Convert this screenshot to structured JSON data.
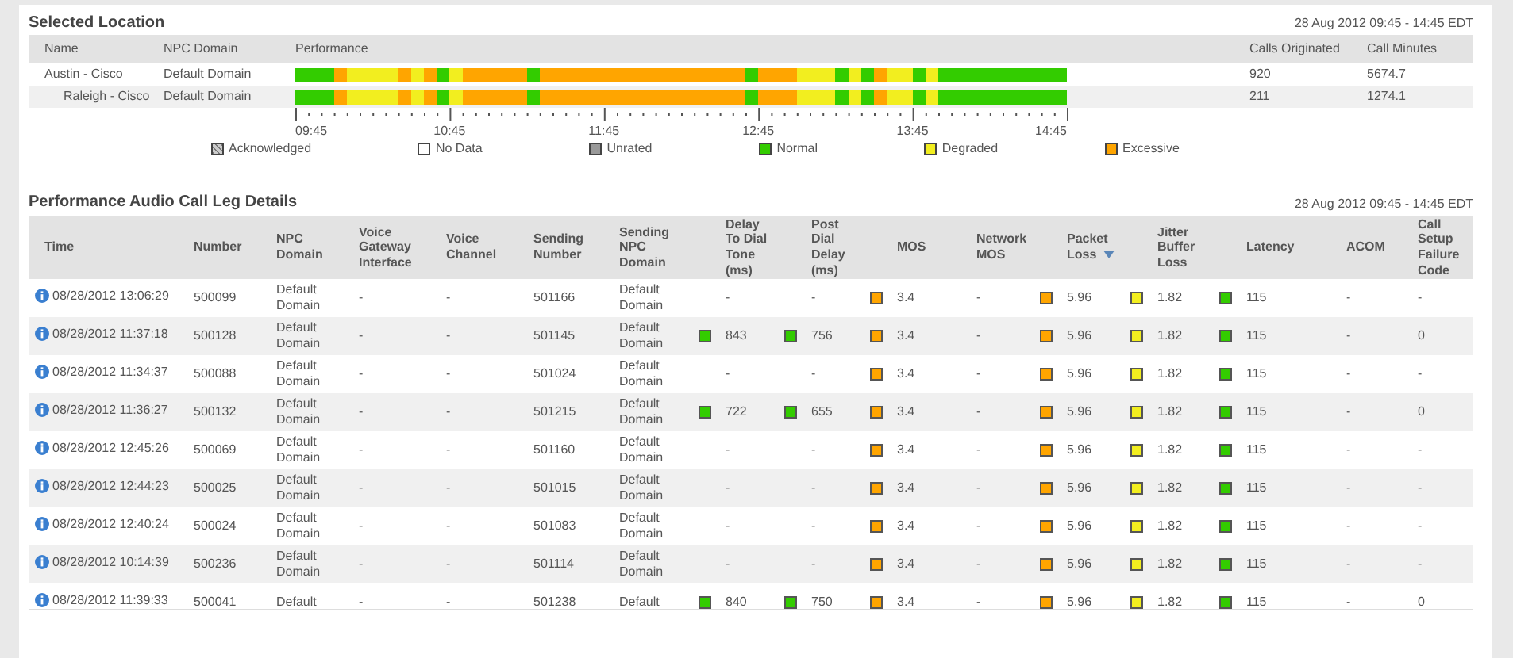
{
  "selected_location": {
    "title": "Selected Location",
    "time_range": "28 Aug 2012 09:45 - 14:45 EDT",
    "columns": [
      "Name",
      "NPC Domain",
      "Performance",
      "Calls Originated",
      "Call Minutes"
    ],
    "locations": [
      {
        "name": "Austin - Cisco",
        "npc_domain": "Default Domain",
        "performance": [
          {
            "color": "#33cc00"
          },
          {
            "color": "#33cc00"
          },
          {
            "color": "#33cc00"
          },
          {
            "color": "#ffa500"
          },
          {
            "color": "#f2ee1f"
          },
          {
            "color": "#f2ee1f"
          },
          {
            "color": "#f2ee1f"
          },
          {
            "color": "#f2ee1f"
          },
          {
            "color": "#ffa500"
          },
          {
            "color": "#f2ee1f"
          },
          {
            "color": "#ffa500"
          },
          {
            "color": "#33cc00"
          },
          {
            "color": "#f2ee1f"
          },
          {
            "color": "#ffa500"
          },
          {
            "color": "#ffa500"
          },
          {
            "color": "#ffa500"
          },
          {
            "color": "#ffa500"
          },
          {
            "color": "#ffa500"
          },
          {
            "color": "#33cc00"
          },
          {
            "color": "#ffa500"
          },
          {
            "color": "#ffa500"
          },
          {
            "color": "#ffa500"
          },
          {
            "color": "#ffa500"
          },
          {
            "color": "#ffa500"
          },
          {
            "color": "#ffa500"
          },
          {
            "color": "#ffa500"
          },
          {
            "color": "#ffa500"
          },
          {
            "color": "#ffa500"
          },
          {
            "color": "#ffa500"
          },
          {
            "color": "#ffa500"
          },
          {
            "color": "#ffa500"
          },
          {
            "color": "#ffa500"
          },
          {
            "color": "#ffa500"
          },
          {
            "color": "#ffa500"
          },
          {
            "color": "#ffa500"
          },
          {
            "color": "#33cc00"
          },
          {
            "color": "#ffa500"
          },
          {
            "color": "#ffa500"
          },
          {
            "color": "#ffa500"
          },
          {
            "color": "#f2ee1f"
          },
          {
            "color": "#f2ee1f"
          },
          {
            "color": "#f2ee1f"
          },
          {
            "color": "#33cc00"
          },
          {
            "color": "#f2ee1f"
          },
          {
            "color": "#33cc00"
          },
          {
            "color": "#ffa500"
          },
          {
            "color": "#f2ee1f"
          },
          {
            "color": "#f2ee1f"
          },
          {
            "color": "#33cc00"
          },
          {
            "color": "#f2ee1f"
          },
          {
            "color": "#33cc00"
          },
          {
            "color": "#33cc00"
          },
          {
            "color": "#33cc00"
          },
          {
            "color": "#33cc00"
          },
          {
            "color": "#33cc00"
          },
          {
            "color": "#33cc00"
          },
          {
            "color": "#33cc00"
          },
          {
            "color": "#33cc00"
          },
          {
            "color": "#33cc00"
          },
          {
            "color": "#33cc00"
          }
        ],
        "calls_originated": "920",
        "call_minutes": "5674.7",
        "children": [
          {
            "name": "Raleigh - Cisco",
            "npc_domain": "Default Domain",
            "performance": [
              {
                "color": "#33cc00"
              },
              {
                "color": "#33cc00"
              },
              {
                "color": "#33cc00"
              },
              {
                "color": "#ffa500"
              },
              {
                "color": "#f2ee1f"
              },
              {
                "color": "#f2ee1f"
              },
              {
                "color": "#f2ee1f"
              },
              {
                "color": "#f2ee1f"
              },
              {
                "color": "#ffa500"
              },
              {
                "color": "#f2ee1f"
              },
              {
                "color": "#ffa500"
              },
              {
                "color": "#33cc00"
              },
              {
                "color": "#f2ee1f"
              },
              {
                "color": "#ffa500"
              },
              {
                "color": "#ffa500"
              },
              {
                "color": "#ffa500"
              },
              {
                "color": "#ffa500"
              },
              {
                "color": "#ffa500"
              },
              {
                "color": "#33cc00"
              },
              {
                "color": "#ffa500"
              },
              {
                "color": "#ffa500"
              },
              {
                "color": "#ffa500"
              },
              {
                "color": "#ffa500"
              },
              {
                "color": "#ffa500"
              },
              {
                "color": "#ffa500"
              },
              {
                "color": "#ffa500"
              },
              {
                "color": "#ffa500"
              },
              {
                "color": "#ffa500"
              },
              {
                "color": "#ffa500"
              },
              {
                "color": "#ffa500"
              },
              {
                "color": "#ffa500"
              },
              {
                "color": "#ffa500"
              },
              {
                "color": "#ffa500"
              },
              {
                "color": "#ffa500"
              },
              {
                "color": "#ffa500"
              },
              {
                "color": "#33cc00"
              },
              {
                "color": "#ffa500"
              },
              {
                "color": "#ffa500"
              },
              {
                "color": "#ffa500"
              },
              {
                "color": "#f2ee1f"
              },
              {
                "color": "#f2ee1f"
              },
              {
                "color": "#f2ee1f"
              },
              {
                "color": "#33cc00"
              },
              {
                "color": "#f2ee1f"
              },
              {
                "color": "#33cc00"
              },
              {
                "color": "#ffa500"
              },
              {
                "color": "#f2ee1f"
              },
              {
                "color": "#f2ee1f"
              },
              {
                "color": "#33cc00"
              },
              {
                "color": "#f2ee1f"
              },
              {
                "color": "#33cc00"
              },
              {
                "color": "#33cc00"
              },
              {
                "color": "#33cc00"
              },
              {
                "color": "#33cc00"
              },
              {
                "color": "#33cc00"
              },
              {
                "color": "#33cc00"
              },
              {
                "color": "#33cc00"
              },
              {
                "color": "#33cc00"
              },
              {
                "color": "#33cc00"
              },
              {
                "color": "#33cc00"
              }
            ],
            "calls_originated": "211",
            "call_minutes": "1274.1"
          }
        ]
      }
    ],
    "axis_labels": [
      "09:45",
      "10:45",
      "11:45",
      "12:45",
      "13:45",
      "14:45"
    ],
    "legend": [
      {
        "label": "Acknowledged",
        "color": "#cccccc",
        "hatched": true
      },
      {
        "label": "No Data",
        "color": "#ffffff",
        "hatched": false
      },
      {
        "label": "Unrated",
        "color": "#999999",
        "hatched": false
      },
      {
        "label": "Normal",
        "color": "#33cc00",
        "hatched": false
      },
      {
        "label": "Degraded",
        "color": "#f2ee1f",
        "hatched": false
      },
      {
        "label": "Excessive",
        "color": "#ffa500",
        "hatched": false
      }
    ]
  },
  "call_leg_details": {
    "title": "Performance Audio Call Leg Details",
    "time_range": "28 Aug 2012 09:45 - 14:45 EDT",
    "columns": [
      {
        "label": "Time",
        "kind": "time",
        "sorted": false
      },
      {
        "label": "Number",
        "kind": "text",
        "sorted": false
      },
      {
        "label": "NPC Domain",
        "kind": "text",
        "sorted": false
      },
      {
        "label": "Voice Gateway Interface",
        "kind": "text",
        "sorted": false
      },
      {
        "label": "Voice Channel",
        "kind": "text",
        "sorted": false
      },
      {
        "label": "Sending Number",
        "kind": "text",
        "sorted": false
      },
      {
        "label": "Sending NPC Domain",
        "kind": "text",
        "sorted": false
      },
      {
        "label": "Delay To Dial Tone (ms)",
        "kind": "indicator",
        "sorted": false
      },
      {
        "label": "Post Dial Delay (ms)",
        "kind": "indicator",
        "sorted": false
      },
      {
        "label": "MOS",
        "kind": "indicator",
        "sorted": false
      },
      {
        "label": "Network MOS",
        "kind": "text",
        "sorted": false
      },
      {
        "label": "Packet Loss",
        "kind": "indicator",
        "sorted": true
      },
      {
        "label": "Jitter Buffer Loss",
        "kind": "indicator",
        "sorted": false
      },
      {
        "label": "Latency",
        "kind": "indicator",
        "sorted": false
      },
      {
        "label": "ACOM",
        "kind": "text",
        "sorted": false
      },
      {
        "label": "Call Setup Failure Code",
        "kind": "text",
        "sorted": false
      }
    ],
    "rows": [
      {
        "cells": [
          {
            "text": "08/28/2012 13:06:29"
          },
          {
            "text": "500099"
          },
          {
            "text": "Default Domain"
          },
          {
            "text": "-"
          },
          {
            "text": "-"
          },
          {
            "text": "501166"
          },
          {
            "text": "Default Domain"
          },
          {
            "text": "-"
          },
          {
            "text": "-"
          },
          {
            "text": "3.4",
            "color": "#ffa500"
          },
          {
            "text": "-"
          },
          {
            "text": "5.96",
            "color": "#ffa500"
          },
          {
            "text": "1.82",
            "color": "#f2ee1f"
          },
          {
            "text": "115",
            "color": "#33cc00"
          },
          {
            "text": "-"
          },
          {
            "text": "-"
          }
        ]
      },
      {
        "cells": [
          {
            "text": "08/28/2012 11:37:18"
          },
          {
            "text": "500128"
          },
          {
            "text": "Default Domain"
          },
          {
            "text": "-"
          },
          {
            "text": "-"
          },
          {
            "text": "501145"
          },
          {
            "text": "Default Domain"
          },
          {
            "text": "843",
            "color": "#33cc00"
          },
          {
            "text": "756",
            "color": "#33cc00"
          },
          {
            "text": "3.4",
            "color": "#ffa500"
          },
          {
            "text": "-"
          },
          {
            "text": "5.96",
            "color": "#ffa500"
          },
          {
            "text": "1.82",
            "color": "#f2ee1f"
          },
          {
            "text": "115",
            "color": "#33cc00"
          },
          {
            "text": "-"
          },
          {
            "text": "0"
          }
        ]
      },
      {
        "cells": [
          {
            "text": "08/28/2012 11:34:37"
          },
          {
            "text": "500088"
          },
          {
            "text": "Default Domain"
          },
          {
            "text": "-"
          },
          {
            "text": "-"
          },
          {
            "text": "501024"
          },
          {
            "text": "Default Domain"
          },
          {
            "text": "-"
          },
          {
            "text": "-"
          },
          {
            "text": "3.4",
            "color": "#ffa500"
          },
          {
            "text": "-"
          },
          {
            "text": "5.96",
            "color": "#ffa500"
          },
          {
            "text": "1.82",
            "color": "#f2ee1f"
          },
          {
            "text": "115",
            "color": "#33cc00"
          },
          {
            "text": "-"
          },
          {
            "text": "-"
          }
        ]
      },
      {
        "cells": [
          {
            "text": "08/28/2012 11:36:27"
          },
          {
            "text": "500132"
          },
          {
            "text": "Default Domain"
          },
          {
            "text": "-"
          },
          {
            "text": "-"
          },
          {
            "text": "501215"
          },
          {
            "text": "Default Domain"
          },
          {
            "text": "722",
            "color": "#33cc00"
          },
          {
            "text": "655",
            "color": "#33cc00"
          },
          {
            "text": "3.4",
            "color": "#ffa500"
          },
          {
            "text": "-"
          },
          {
            "text": "5.96",
            "color": "#ffa500"
          },
          {
            "text": "1.82",
            "color": "#f2ee1f"
          },
          {
            "text": "115",
            "color": "#33cc00"
          },
          {
            "text": "-"
          },
          {
            "text": "0"
          }
        ]
      },
      {
        "cells": [
          {
            "text": "08/28/2012 12:45:26"
          },
          {
            "text": "500069"
          },
          {
            "text": "Default Domain"
          },
          {
            "text": "-"
          },
          {
            "text": "-"
          },
          {
            "text": "501160"
          },
          {
            "text": "Default Domain"
          },
          {
            "text": "-"
          },
          {
            "text": "-"
          },
          {
            "text": "3.4",
            "color": "#ffa500"
          },
          {
            "text": "-"
          },
          {
            "text": "5.96",
            "color": "#ffa500"
          },
          {
            "text": "1.82",
            "color": "#f2ee1f"
          },
          {
            "text": "115",
            "color": "#33cc00"
          },
          {
            "text": "-"
          },
          {
            "text": "-"
          }
        ]
      },
      {
        "cells": [
          {
            "text": "08/28/2012 12:44:23"
          },
          {
            "text": "500025"
          },
          {
            "text": "Default Domain"
          },
          {
            "text": "-"
          },
          {
            "text": "-"
          },
          {
            "text": "501015"
          },
          {
            "text": "Default Domain"
          },
          {
            "text": "-"
          },
          {
            "text": "-"
          },
          {
            "text": "3.4",
            "color": "#ffa500"
          },
          {
            "text": "-"
          },
          {
            "text": "5.96",
            "color": "#ffa500"
          },
          {
            "text": "1.82",
            "color": "#f2ee1f"
          },
          {
            "text": "115",
            "color": "#33cc00"
          },
          {
            "text": "-"
          },
          {
            "text": "-"
          }
        ]
      },
      {
        "cells": [
          {
            "text": "08/28/2012 12:40:24"
          },
          {
            "text": "500024"
          },
          {
            "text": "Default Domain"
          },
          {
            "text": "-"
          },
          {
            "text": "-"
          },
          {
            "text": "501083"
          },
          {
            "text": "Default Domain"
          },
          {
            "text": "-"
          },
          {
            "text": "-"
          },
          {
            "text": "3.4",
            "color": "#ffa500"
          },
          {
            "text": "-"
          },
          {
            "text": "5.96",
            "color": "#ffa500"
          },
          {
            "text": "1.82",
            "color": "#f2ee1f"
          },
          {
            "text": "115",
            "color": "#33cc00"
          },
          {
            "text": "-"
          },
          {
            "text": "-"
          }
        ]
      },
      {
        "cells": [
          {
            "text": "08/28/2012 10:14:39"
          },
          {
            "text": "500236"
          },
          {
            "text": "Default Domain"
          },
          {
            "text": "-"
          },
          {
            "text": "-"
          },
          {
            "text": "501114"
          },
          {
            "text": "Default Domain"
          },
          {
            "text": "-"
          },
          {
            "text": "-"
          },
          {
            "text": "3.4",
            "color": "#ffa500"
          },
          {
            "text": "-"
          },
          {
            "text": "5.96",
            "color": "#ffa500"
          },
          {
            "text": "1.82",
            "color": "#f2ee1f"
          },
          {
            "text": "115",
            "color": "#33cc00"
          },
          {
            "text": "-"
          },
          {
            "text": "-"
          }
        ]
      },
      {
        "cells": [
          {
            "text": "08/28/2012 11:39:33"
          },
          {
            "text": "500041"
          },
          {
            "text": "Default"
          },
          {
            "text": "-"
          },
          {
            "text": "-"
          },
          {
            "text": "501238"
          },
          {
            "text": "Default"
          },
          {
            "text": "840",
            "color": "#33cc00"
          },
          {
            "text": "750",
            "color": "#33cc00"
          },
          {
            "text": "3.4",
            "color": "#ffa500"
          },
          {
            "text": "-"
          },
          {
            "text": "5.96",
            "color": "#ffa500"
          },
          {
            "text": "1.82",
            "color": "#f2ee1f"
          },
          {
            "text": "115",
            "color": "#33cc00"
          },
          {
            "text": "-"
          },
          {
            "text": "0"
          }
        ]
      }
    ]
  }
}
